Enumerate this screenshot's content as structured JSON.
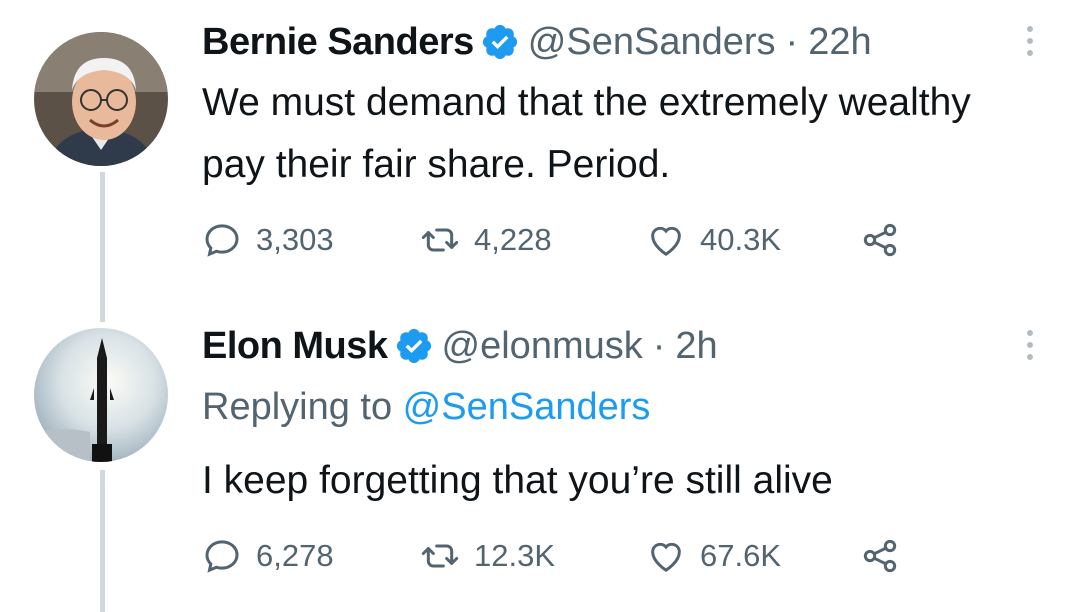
{
  "tweets": [
    {
      "name": "Bernie Sanders",
      "handle": "@SenSanders",
      "separator": "·",
      "time": "22h",
      "reply_prefix": "",
      "reply_handle": "",
      "text": "We must demand that the extremely wealthy pay their fair share. Period.",
      "replies": "3,303",
      "retweets": "4,228",
      "likes": "40.3K"
    },
    {
      "name": "Elon Musk",
      "handle": "@elonmusk",
      "separator": "·",
      "time": "2h",
      "reply_prefix": "Replying to ",
      "reply_handle": "@SenSanders",
      "text": "I keep forgetting that you’re still alive",
      "replies": "6,278",
      "retweets": "12.3K",
      "likes": "67.6K"
    }
  ],
  "icons": {
    "reply": "reply-icon",
    "retweet": "retweet-icon",
    "like": "heart-icon",
    "share": "share-icon",
    "verified": "verified-badge-icon",
    "more": "more-vertical-icon"
  },
  "colors": {
    "verified": "#1d9bf0",
    "link": "#1d9bf0",
    "secondary_text": "#536471",
    "thread_line": "#cfd9de"
  }
}
